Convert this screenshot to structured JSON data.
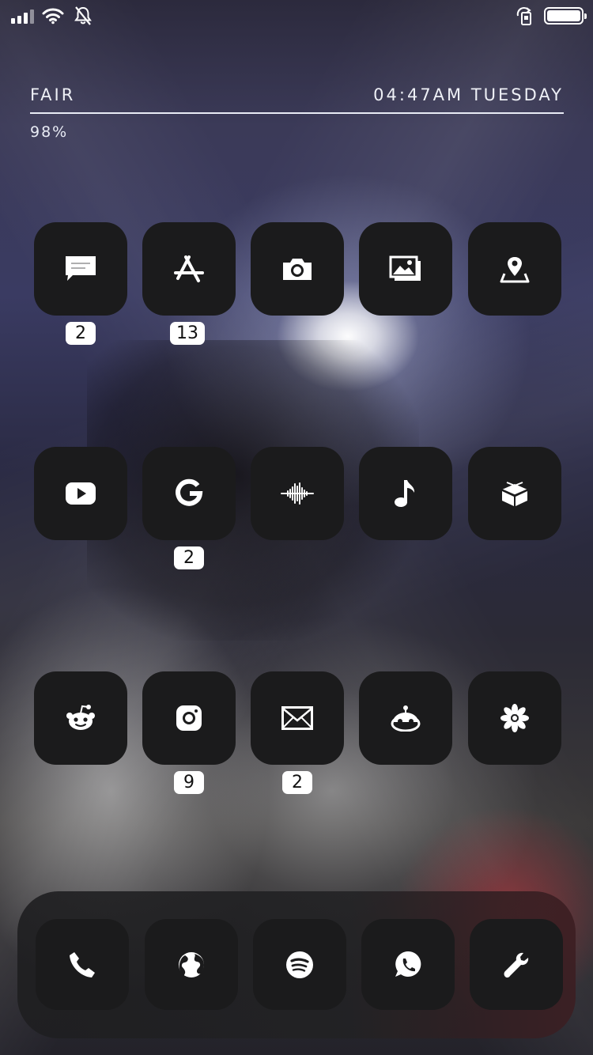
{
  "status_bar": {
    "signal_icon": "cellular-signal-icon",
    "wifi_icon": "wifi-icon",
    "silent_icon": "bell-slash-icon",
    "rotation_lock_icon": "rotation-lock-icon",
    "battery_icon": "battery-full-icon"
  },
  "widget": {
    "condition": "FAIR",
    "time_day": "04:47AM TUESDAY",
    "battery": "98%"
  },
  "home": {
    "row1": [
      {
        "app": "Messages",
        "icon": "message-icon",
        "badge": "2"
      },
      {
        "app": "App Store",
        "icon": "app-store-icon",
        "badge": "13"
      },
      {
        "app": "Camera",
        "icon": "camera-icon",
        "badge": ""
      },
      {
        "app": "Photos",
        "icon": "photos-icon",
        "badge": ""
      },
      {
        "app": "Maps",
        "icon": "map-pin-icon",
        "badge": ""
      }
    ],
    "row2": [
      {
        "app": "YouTube",
        "icon": "youtube-icon",
        "badge": ""
      },
      {
        "app": "Google",
        "icon": "google-icon",
        "badge": "2"
      },
      {
        "app": "Voice Memos",
        "icon": "waveform-icon",
        "badge": ""
      },
      {
        "app": "Music",
        "icon": "music-note-icon",
        "badge": ""
      },
      {
        "app": "Cydia",
        "icon": "cydia-box-icon",
        "badge": ""
      }
    ],
    "row3": [
      {
        "app": "Reddit",
        "icon": "reddit-icon",
        "badge": ""
      },
      {
        "app": "Instagram",
        "icon": "instagram-icon",
        "badge": "9"
      },
      {
        "app": "Mail",
        "icon": "mail-icon",
        "badge": "2"
      },
      {
        "app": "Apollo",
        "icon": "robot-icon",
        "badge": ""
      },
      {
        "app": "Flower",
        "icon": "flower-icon",
        "badge": ""
      }
    ]
  },
  "dock": [
    {
      "app": "Phone",
      "icon": "phone-icon"
    },
    {
      "app": "Browser",
      "icon": "globe-icon"
    },
    {
      "app": "Spotify",
      "icon": "spotify-icon"
    },
    {
      "app": "WhatsApp",
      "icon": "whatsapp-icon"
    },
    {
      "app": "Settings",
      "icon": "wrench-icon"
    }
  ],
  "colors": {
    "icon_bg": "#1b1b1c",
    "glyph": "#ffffff",
    "badge_bg": "#ffffff",
    "badge_text": "#111111"
  }
}
